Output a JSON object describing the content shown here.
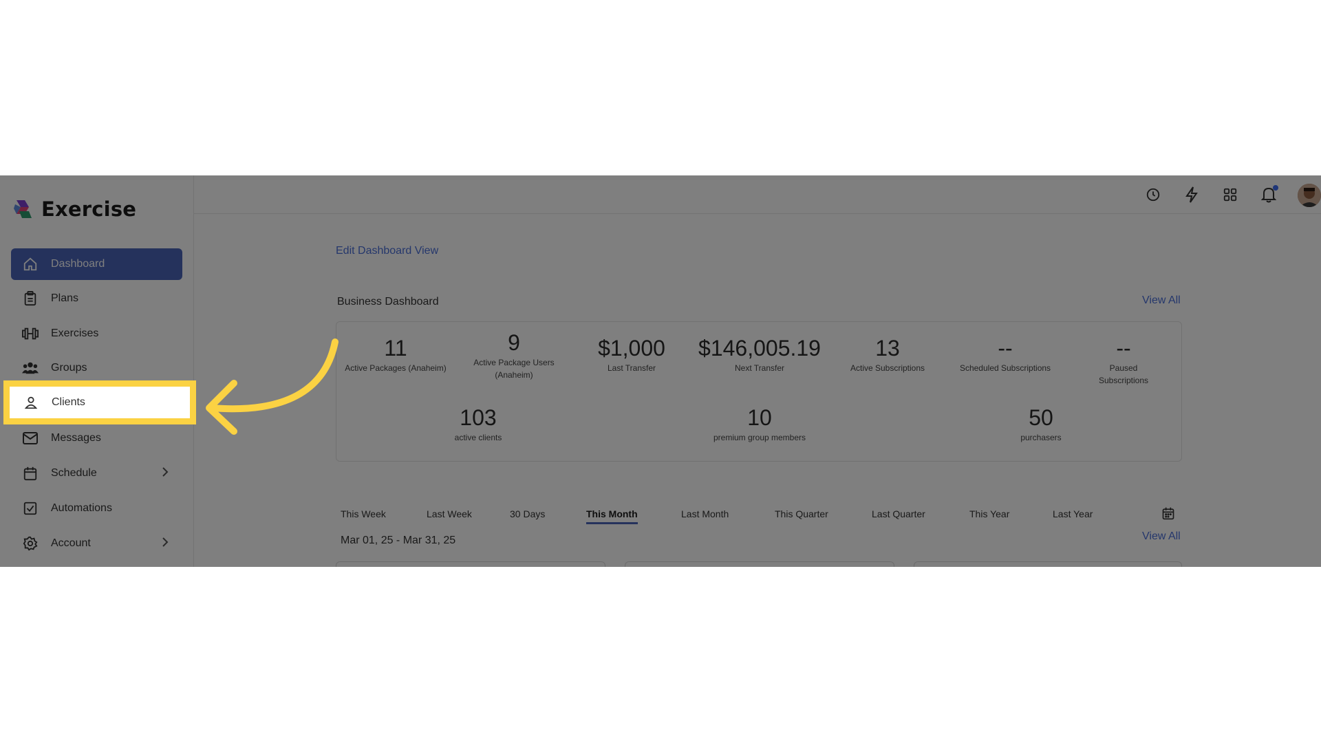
{
  "app": {
    "name": "Exercise"
  },
  "sidebar": {
    "items": [
      {
        "label": "Dashboard",
        "icon": "home-icon"
      },
      {
        "label": "Plans",
        "icon": "clipboard-icon"
      },
      {
        "label": "Exercises",
        "icon": "dumbbell-icon"
      },
      {
        "label": "Groups",
        "icon": "users-icon"
      },
      {
        "label": "Clients",
        "icon": "user-icon"
      },
      {
        "label": "Messages",
        "icon": "mail-icon"
      },
      {
        "label": "Schedule",
        "icon": "calendar-icon"
      },
      {
        "label": "Automations",
        "icon": "checkbox-icon"
      },
      {
        "label": "Account",
        "icon": "gear-icon"
      }
    ]
  },
  "topbar": {
    "icons": [
      "clock-icon",
      "bolt-icon",
      "apps-grid-icon",
      "bell-icon"
    ]
  },
  "dashboard": {
    "edit_link": "Edit Dashboard View",
    "section_title": "Business Dashboard",
    "view_all": "View All",
    "stats_row1": [
      {
        "value": "11",
        "label": "Active Packages (Anaheim)"
      },
      {
        "value": "9",
        "label": "Active Package Users",
        "label2": "(Anaheim)"
      },
      {
        "value": "$1,000",
        "label": "Last Transfer"
      },
      {
        "value": "$146,005.19",
        "label": "Next Transfer"
      },
      {
        "value": "13",
        "label": "Active Subscriptions"
      },
      {
        "value": "--",
        "label": "Scheduled Subscriptions"
      },
      {
        "value": "--",
        "label": "Paused Subscriptions"
      }
    ],
    "stats_row2": [
      {
        "value": "103",
        "label": "active clients"
      },
      {
        "value": "10",
        "label": "premium group members"
      },
      {
        "value": "50",
        "label": "purchasers"
      }
    ],
    "tabs": [
      "This Week",
      "Last Week",
      "30 Days",
      "This Month",
      "Last Month",
      "This Quarter",
      "Last Quarter",
      "This Year",
      "Last Year"
    ],
    "active_tab": "This Month",
    "date_range": "Mar 01, 25 - Mar 31, 25",
    "view_all_2": "View All"
  },
  "colors": {
    "accent": "#4a64b8",
    "link": "#4a6fd8",
    "highlight": "#fbd243"
  }
}
